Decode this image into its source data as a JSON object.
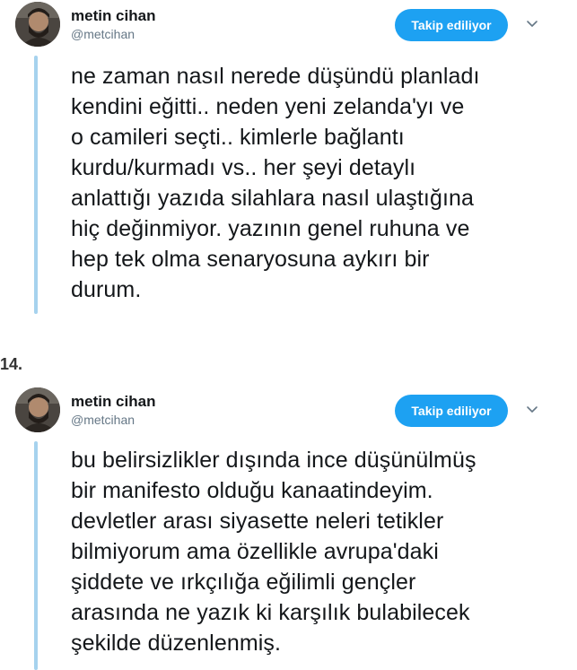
{
  "tweets": [
    {
      "author_name": "metin cihan",
      "author_handle": "@metcihan",
      "follow_label": "Takip ediliyor",
      "text": "ne zaman nasıl nerede düşündü planladı\nkendini eğitti.. neden yeni zelanda'yı ve\no camileri seçti.. kimlerle bağlantı\nkurdu/kurmadı vs.. her şeyi detaylı\nanlattığı yazıda silahlara nasıl ulaştığına\nhiç değinmiyor. yazının genel ruhuna ve\nhep tek olma senaryosuna aykırı bir\ndurum."
    },
    {
      "author_name": "metin cihan",
      "author_handle": "@metcihan",
      "follow_label": "Takip ediliyor",
      "text": "bu belirsizlikler dışında ince düşünülmüş\nbir manifesto olduğu kanaatindeyim.\ndevletler arası siyasette neleri tetikler\nbilmiyorum ama özellikle avrupa'daki\nşiddete ve ırkçılığa eğilimli gençler\narasında ne yazık ki karşılık bulabilecek\nşekilde düzenlenmiş."
    }
  ],
  "number_label": "14.",
  "icons": {
    "avatar": "profile-photo",
    "menu": "chevron-down-icon"
  },
  "colors": {
    "accent": "#1da1f2",
    "thread_line": "#a6d2ee",
    "text": "#14171a",
    "handle": "#657786"
  }
}
